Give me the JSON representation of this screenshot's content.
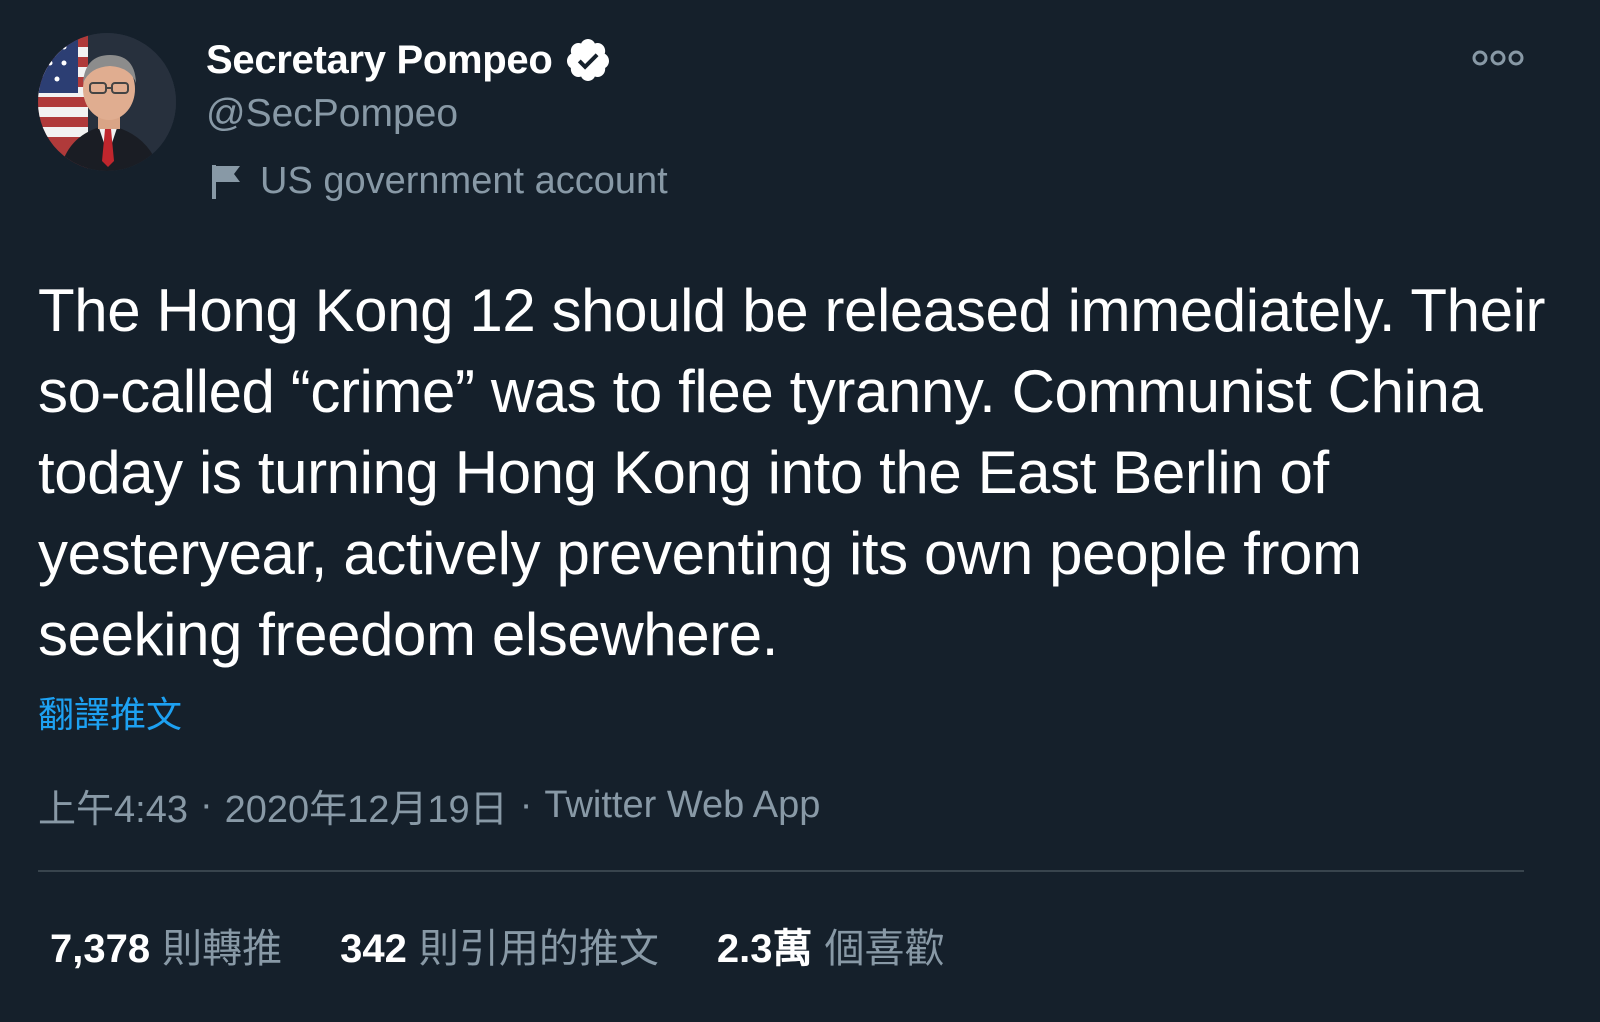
{
  "author": {
    "display_name": "Secretary Pompeo",
    "handle": "@SecPompeo",
    "label": "US government account",
    "avatar_icon": "profile-photo",
    "verified_icon": "verified-badge-icon",
    "label_icon": "flag-icon"
  },
  "tweet": {
    "text": "The Hong Kong 12 should be released immediately. Their so-called “crime” was to flee tyranny. Communist China today is turning Hong Kong into the East Berlin of yesteryear, actively preventing its own people from seeking freedom elsewhere.",
    "translate_label": "翻譯推文",
    "time": "上午4:43",
    "date": "2020年12月19日",
    "separator": "·",
    "source": "Twitter Web App"
  },
  "stats": {
    "retweets": {
      "count": "7,378",
      "label": "則轉推"
    },
    "quotes": {
      "count": "342",
      "label": "則引用的推文"
    },
    "likes": {
      "count": "2.3萬",
      "label": "個喜歡"
    }
  },
  "colors": {
    "background": "#15202b",
    "text_primary": "#ffffff",
    "text_secondary": "#8899a6",
    "link": "#1da1f2",
    "divider": "#38444d"
  },
  "more_icon": "more-options-icon"
}
